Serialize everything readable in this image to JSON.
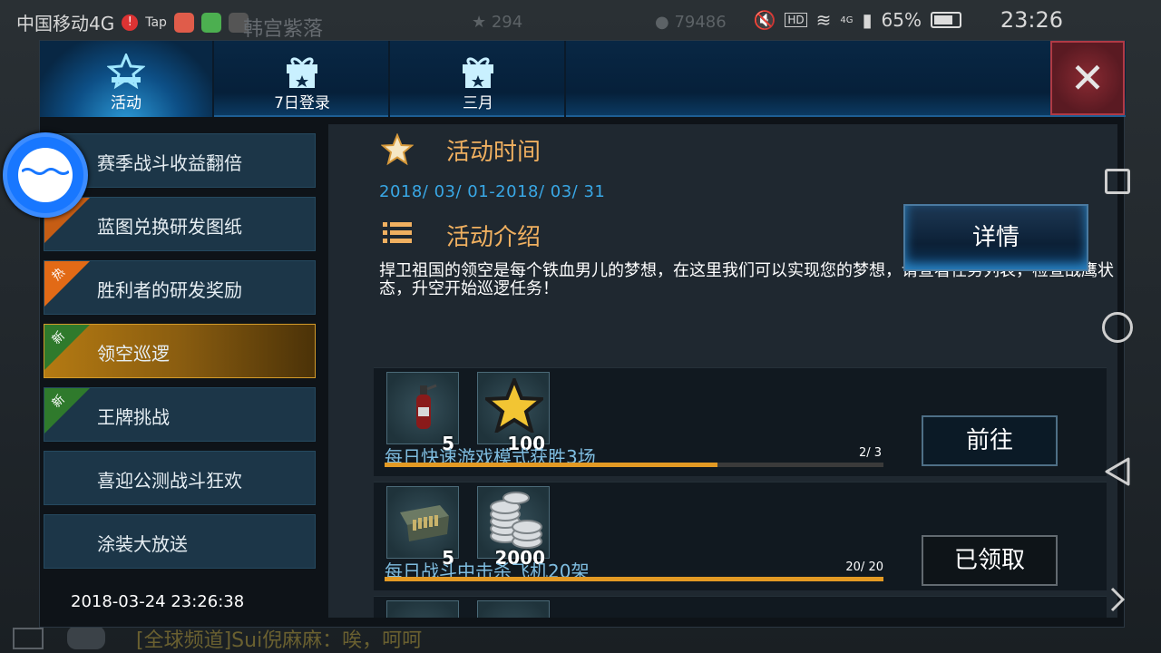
{
  "status_bar": {
    "carrier": "中国移动4G",
    "app_tag": "Tap",
    "battery": "65%",
    "time": "23:26",
    "network": "4G"
  },
  "background": {
    "title_text": "韩宫紫落",
    "stars": "294",
    "coins": "79486",
    "chat_text": "[全球频道]Sui倪麻麻：唉，呵呵"
  },
  "tabs": [
    {
      "label": "活动",
      "icon": "star-badge-icon",
      "active": true
    },
    {
      "label": "7日登录",
      "icon": "gift-icon",
      "active": false
    },
    {
      "label": "三月",
      "icon": "gift-icon",
      "active": false
    }
  ],
  "close_label": "✕",
  "side_items": [
    {
      "label": "赛季战斗收益翻倍",
      "tag": ""
    },
    {
      "label": "蓝图兑换研发图纸",
      "tag": ""
    },
    {
      "label": "胜利者的研发奖励",
      "tag": "热"
    },
    {
      "label": "领空巡逻",
      "tag": "新"
    },
    {
      "label": "王牌挑战",
      "tag": "新"
    },
    {
      "label": "喜迎公测战斗狂欢",
      "tag": ""
    },
    {
      "label": "涂装大放送",
      "tag": ""
    }
  ],
  "clock": "2018-03-24 23:26:38",
  "activity": {
    "time_title": "活动时间",
    "date_range": "2018/ 03/ 01-2018/ 03/ 31",
    "intro_title": "活动介绍",
    "description": "捍卫祖国的领空是每个铁血男儿的梦想，在这里我们可以实现您的梦想，请查看任务列表，检查战鹰状态，升空开始巡逻任务！",
    "detail_button": "详情"
  },
  "tasks": [
    {
      "title": "每日快速游戏模式获胜3场",
      "rewards": [
        {
          "icon": "fire-extinguisher-icon",
          "qty": "5"
        },
        {
          "icon": "gold-star-icon",
          "qty": "100"
        }
      ],
      "progress_text": "2/ 3",
      "progress": 0.667,
      "button": "前往",
      "claimed": false
    },
    {
      "title": "每日战斗中击杀飞机20架",
      "rewards": [
        {
          "icon": "ammo-box-icon",
          "qty": "5"
        },
        {
          "icon": "silver-coins-icon",
          "qty": "2000"
        }
      ],
      "progress_text": "20/ 20",
      "progress": 1.0,
      "button": "已领取",
      "claimed": true
    }
  ]
}
